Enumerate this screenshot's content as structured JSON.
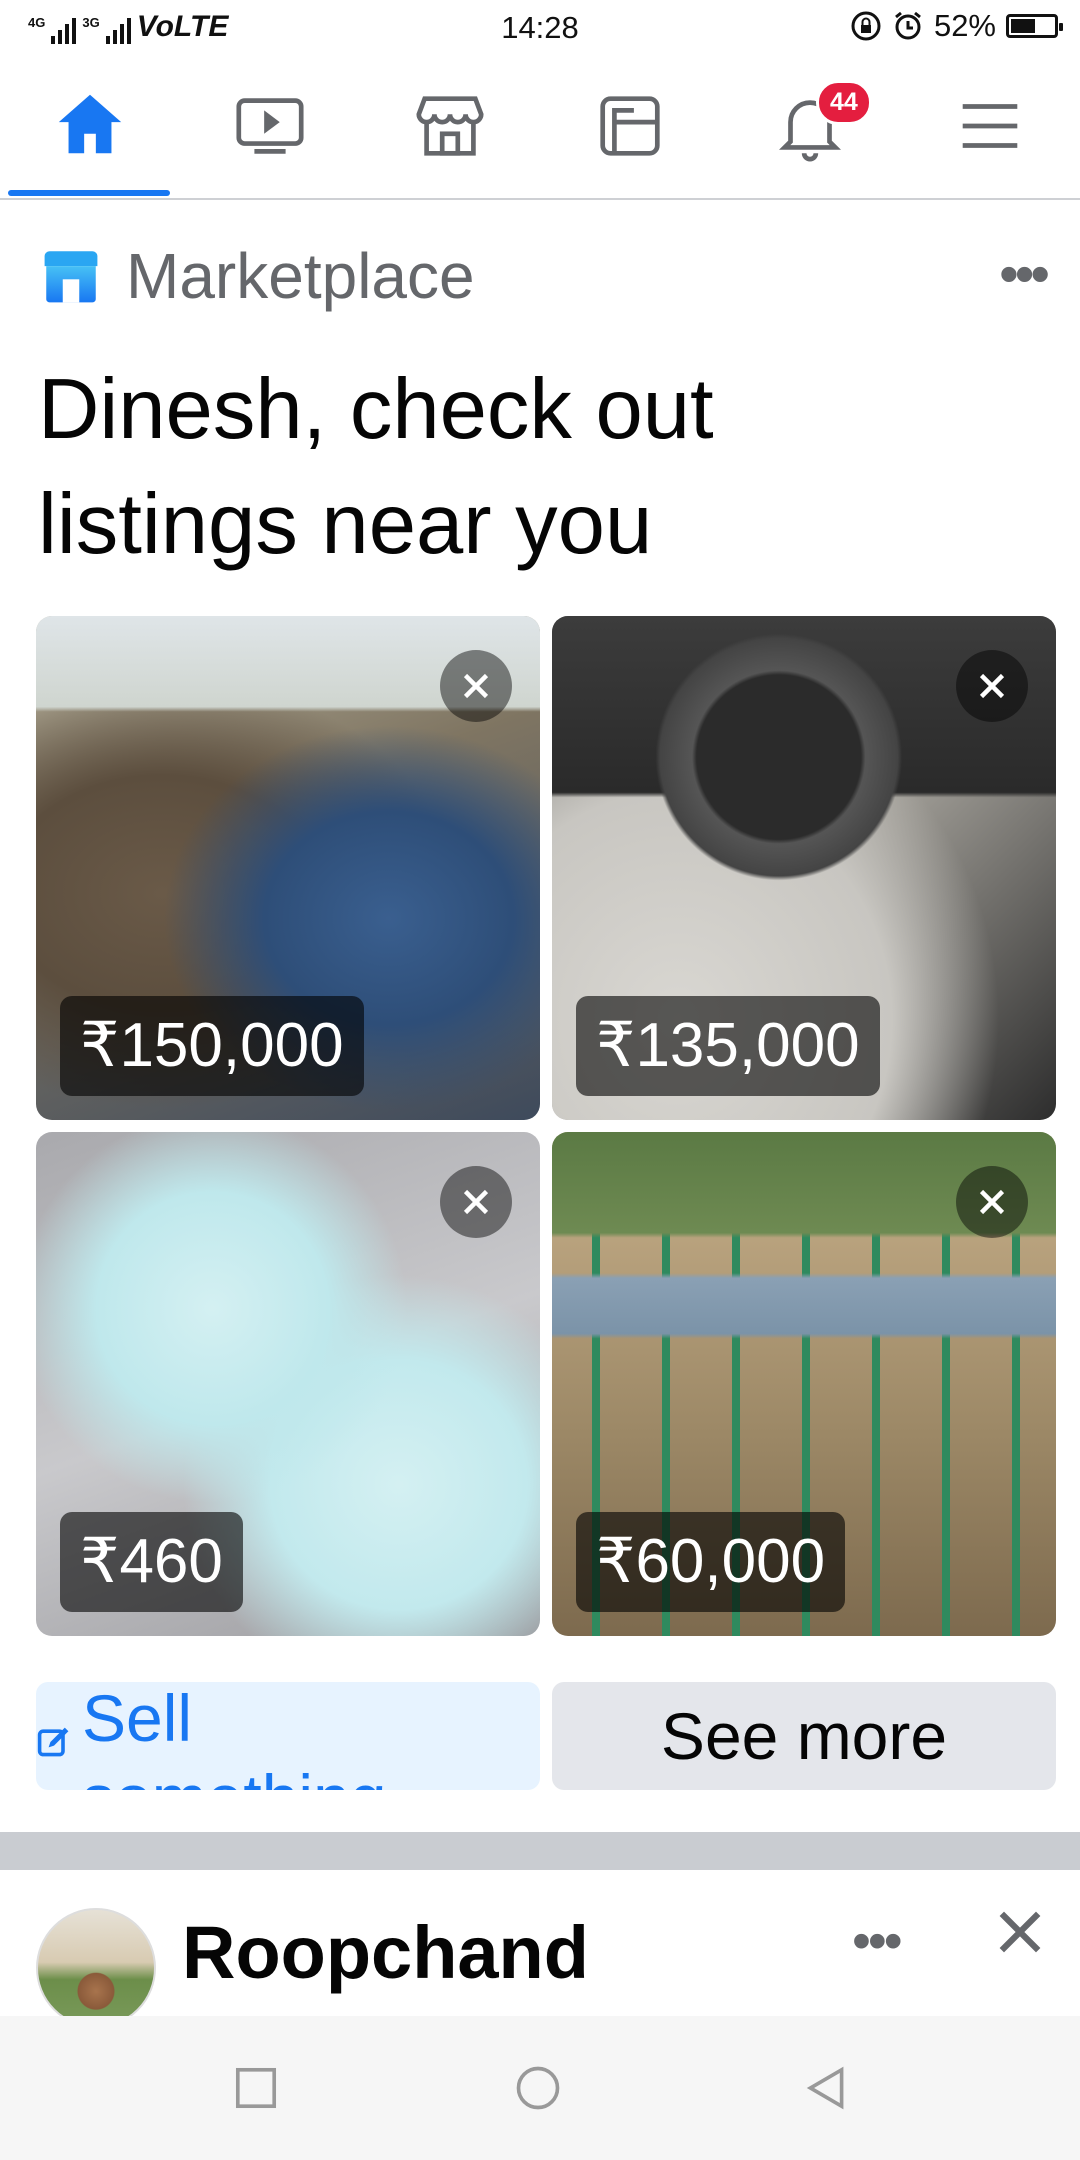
{
  "status_bar": {
    "network_small": "4G",
    "network_small_2": "3G",
    "carrier_tech": "VoLTE",
    "time": "14:28",
    "battery": "52%"
  },
  "nav": {
    "notification_count": "44",
    "accent_color": "#1877f2",
    "items": [
      "home-icon",
      "watch-icon",
      "marketplace-icon",
      "pages-icon",
      "bell-icon",
      "menu-icon"
    ]
  },
  "marketplace": {
    "title": "Marketplace",
    "headline": "Dinesh, check out listings near you",
    "listings": [
      {
        "price": "₹150,000"
      },
      {
        "price": "₹135,000"
      },
      {
        "price": "₹460"
      },
      {
        "price": "₹60,000"
      }
    ],
    "sell_label": "Sell something",
    "see_more_label": "See more"
  },
  "post": {
    "author": "Roopchand Prajapati"
  }
}
